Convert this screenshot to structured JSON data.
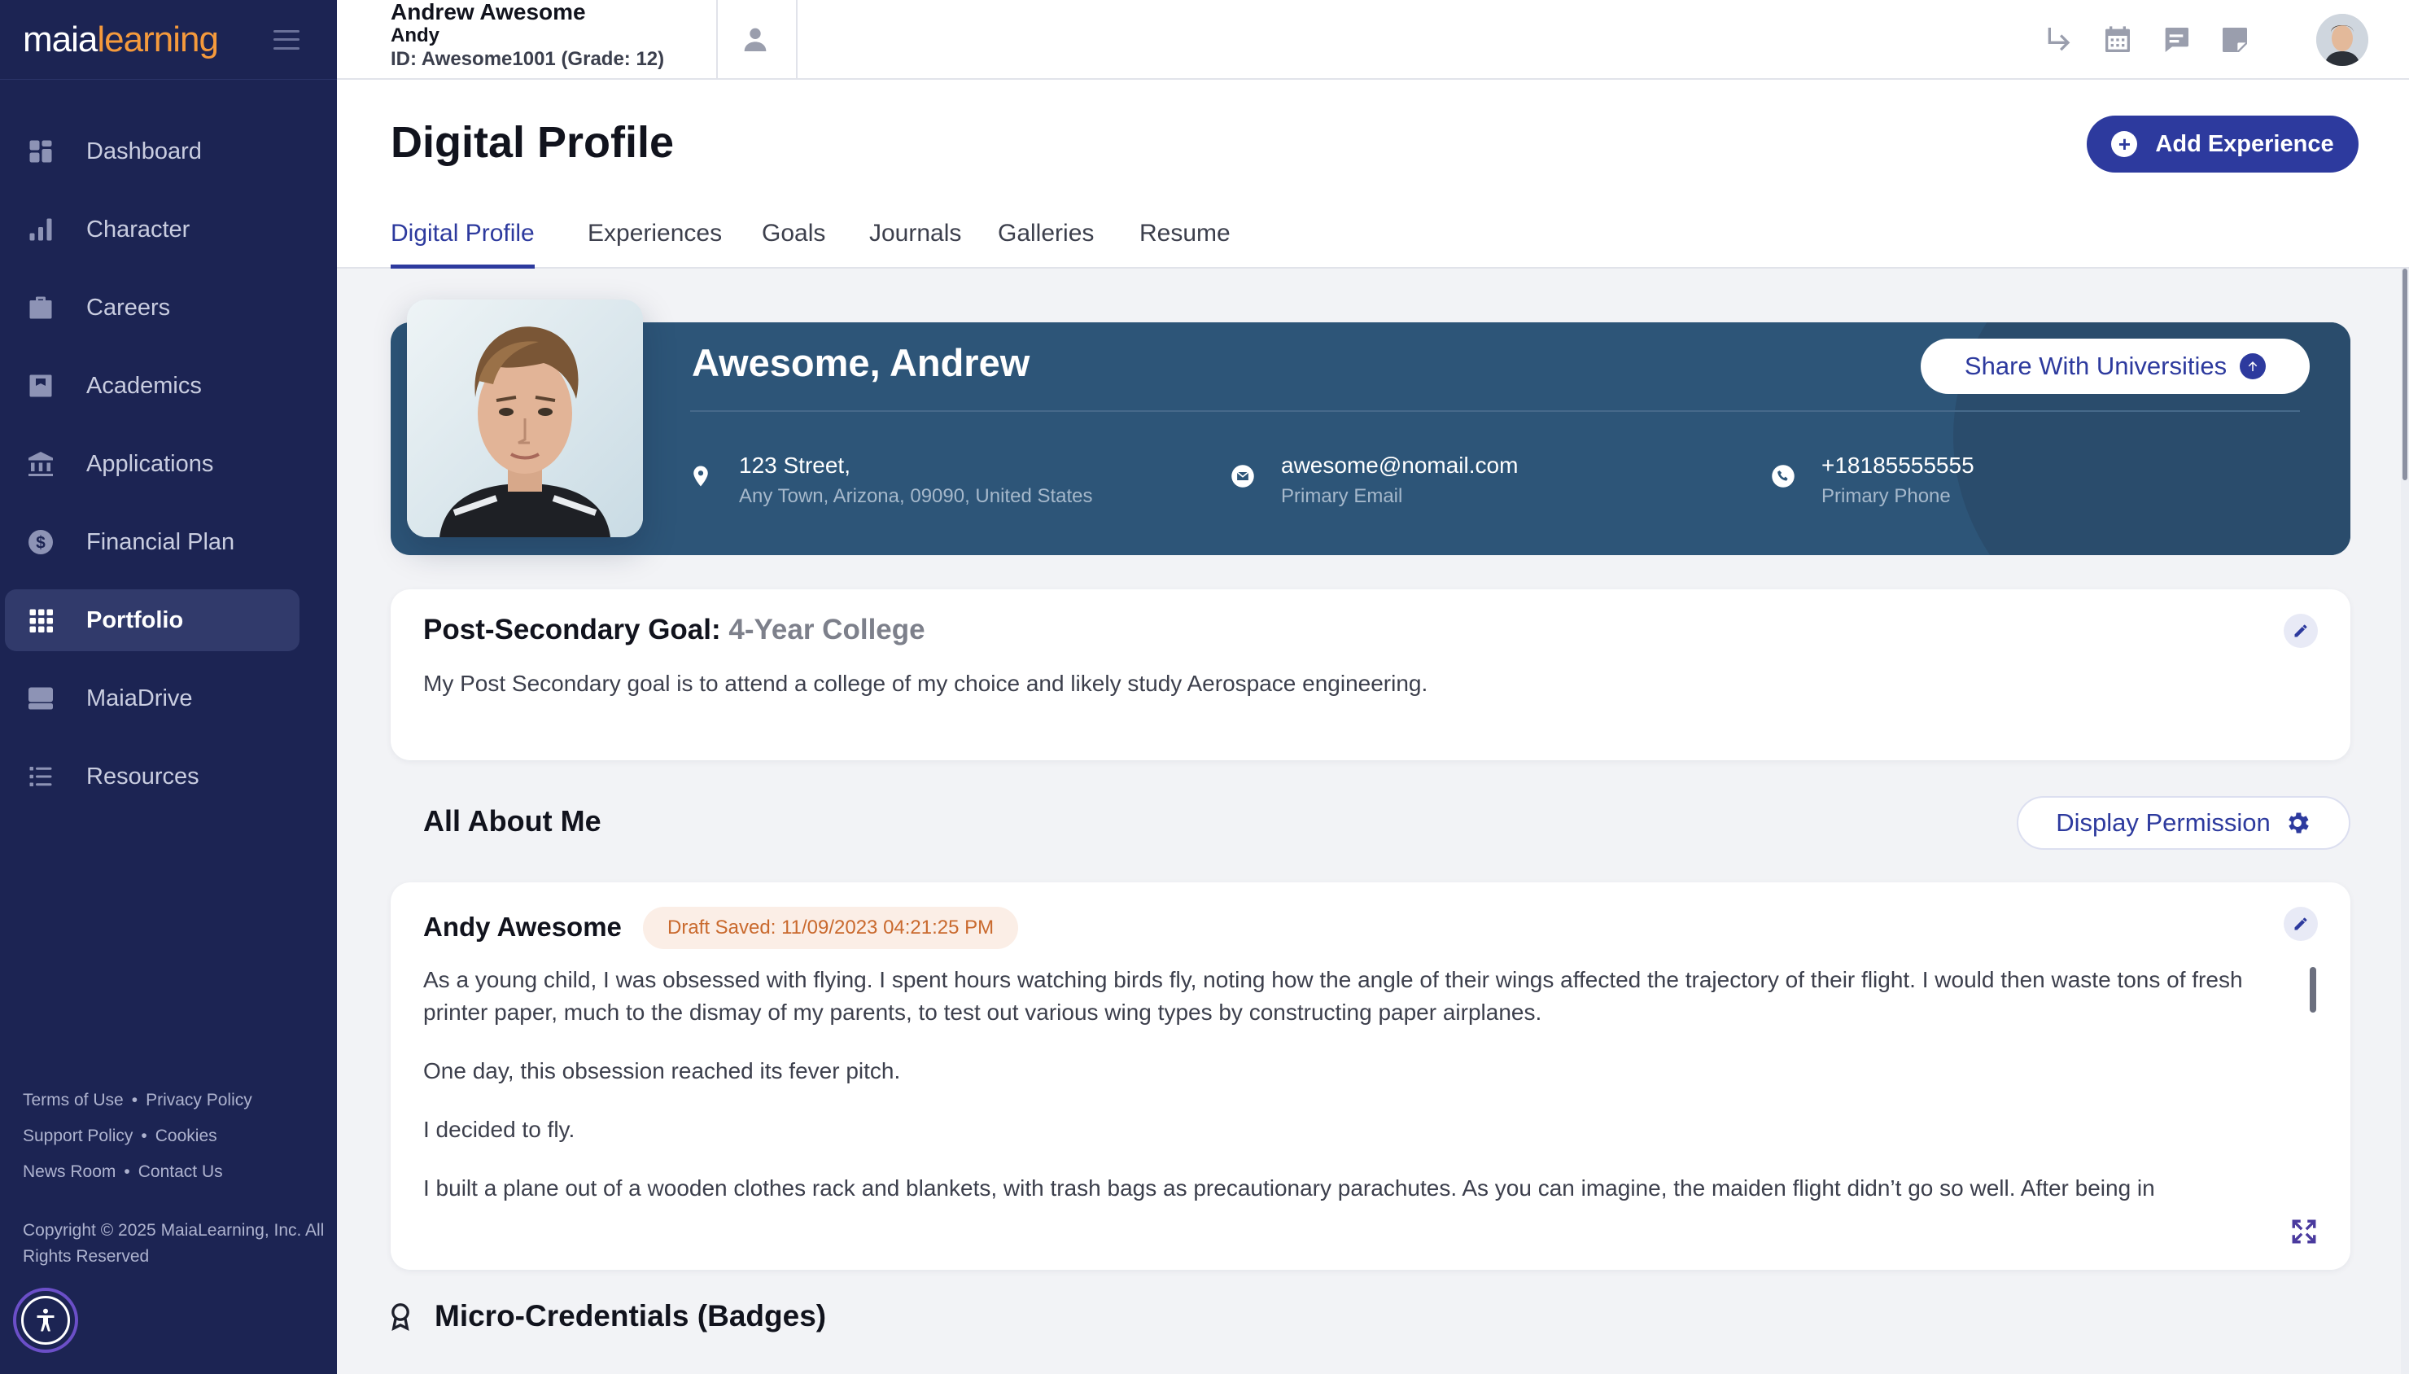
{
  "sidebar": {
    "logo_part1": "maia",
    "logo_part2": "learning",
    "items": [
      {
        "label": "Dashboard",
        "icon": "dashboard-icon"
      },
      {
        "label": "Character",
        "icon": "bar-chart-icon"
      },
      {
        "label": "Careers",
        "icon": "briefcase-icon"
      },
      {
        "label": "Academics",
        "icon": "academic-book-icon"
      },
      {
        "label": "Applications",
        "icon": "institution-icon"
      },
      {
        "label": "Financial Plan",
        "icon": "dollar-icon"
      },
      {
        "label": "Portfolio",
        "icon": "grid-icon",
        "active": true
      },
      {
        "label": "MaiaDrive",
        "icon": "drive-icon"
      },
      {
        "label": "Resources",
        "icon": "list-icon"
      }
    ],
    "footer": {
      "terms": "Terms of Use",
      "privacy": "Privacy Policy",
      "support": "Support Policy",
      "cookies": "Cookies",
      "news": "News Room",
      "contact": "Contact Us",
      "copyright": "Copyright © 2025 MaiaLearning, Inc. All Rights Reserved"
    }
  },
  "topbar": {
    "student_name": "Andrew Awesome",
    "student_nick": "Andy",
    "student_id": "ID: Awesome1001 (Grade: 12)",
    "icons": [
      "redirect-arrow-icon",
      "calendar-icon",
      "chat-icon",
      "sticky-note-icon",
      "user-avatar"
    ]
  },
  "page": {
    "title": "Digital Profile",
    "add_experience": "Add Experience",
    "tabs": [
      "Digital Profile",
      "Experiences",
      "Goals",
      "Journals",
      "Galleries",
      "Resume"
    ],
    "active_tab": "Digital Profile"
  },
  "profile": {
    "name": "Awesome, Andrew",
    "share_button": "Share With Universities",
    "address_line1": "123 Street,",
    "address_line2": "Any Town, Arizona, 09090, United States",
    "email": "awesome@nomail.com",
    "email_label": "Primary Email",
    "phone": "+18185555555",
    "phone_label": "Primary Phone"
  },
  "goal": {
    "label": "Post-Secondary Goal:",
    "value": "4-Year College",
    "text": "My Post Secondary goal is to attend a college of my choice and likely study Aerospace engineering."
  },
  "about": {
    "section_title": "All About Me",
    "display_permission": "Display Permission",
    "author": "Andy Awesome",
    "draft_status": "Draft Saved: 11/09/2023 04:21:25 PM",
    "paragraphs": [
      "As a young child, I was obsessed with flying. I spent hours watching birds fly, noting how the angle of their wings affected the trajectory of their flight. I would then waste tons of fresh printer paper, much to the dismay of my parents, to test out various wing types by constructing paper airplanes.",
      "One day, this obsession reached its fever pitch.",
      "I decided to fly.",
      "I built a plane out of a wooden clothes rack and blankets, with trash bags as precautionary parachutes. As you can imagine, the maiden flight didn’t go so well. After being in"
    ]
  },
  "badges": {
    "title": "Micro-Credentials (Badges)"
  },
  "colors": {
    "sidebar_bg": "#1c2453",
    "accent": "#2d3a9e",
    "banner_bg": "#2d5578",
    "logo_orange": "#f59a3c",
    "draft_text": "#c9692d"
  }
}
